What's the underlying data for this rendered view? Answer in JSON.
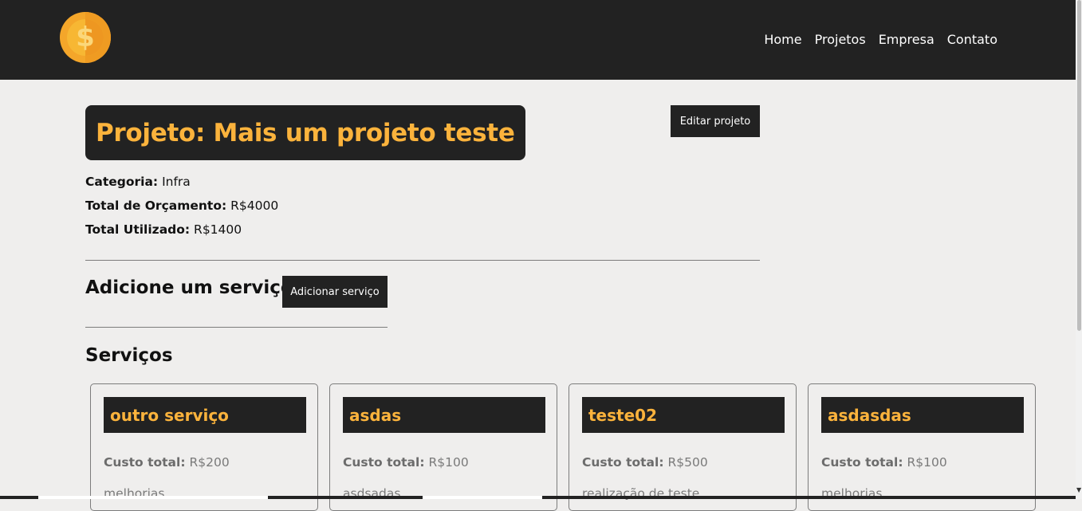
{
  "nav": {
    "logo_symbol": "$",
    "links": [
      "Home",
      "Projetos",
      "Empresa",
      "Contato"
    ]
  },
  "project": {
    "title": "Projeto: Mais um projeto teste",
    "edit_button": "Editar projeto",
    "category_label": "Categoria:",
    "category_value": "Infra",
    "budget_label": "Total de Orçamento:",
    "budget_value": "R$4000",
    "used_label": "Total Utilizado:",
    "used_value": "R$1400"
  },
  "add_service": {
    "heading": "Adicione um serviço:",
    "button": "Adicionar serviço"
  },
  "services": {
    "heading": "Serviços",
    "cost_label": "Custo total:",
    "items": [
      {
        "name": "outro serviço",
        "cost": "R$200",
        "description": "melhorias"
      },
      {
        "name": "asdas",
        "cost": "R$100",
        "description": "asdsadas"
      },
      {
        "name": "teste02",
        "cost": "R$500",
        "description": "realização de teste"
      },
      {
        "name": "asdasdas",
        "cost": "R$100",
        "description": "melhorias"
      }
    ]
  },
  "colors": {
    "nav_bg": "#222222",
    "accent": "#fbb33c",
    "page_bg": "#efeeed"
  },
  "icons": [
    "coin-dollar-icon"
  ]
}
